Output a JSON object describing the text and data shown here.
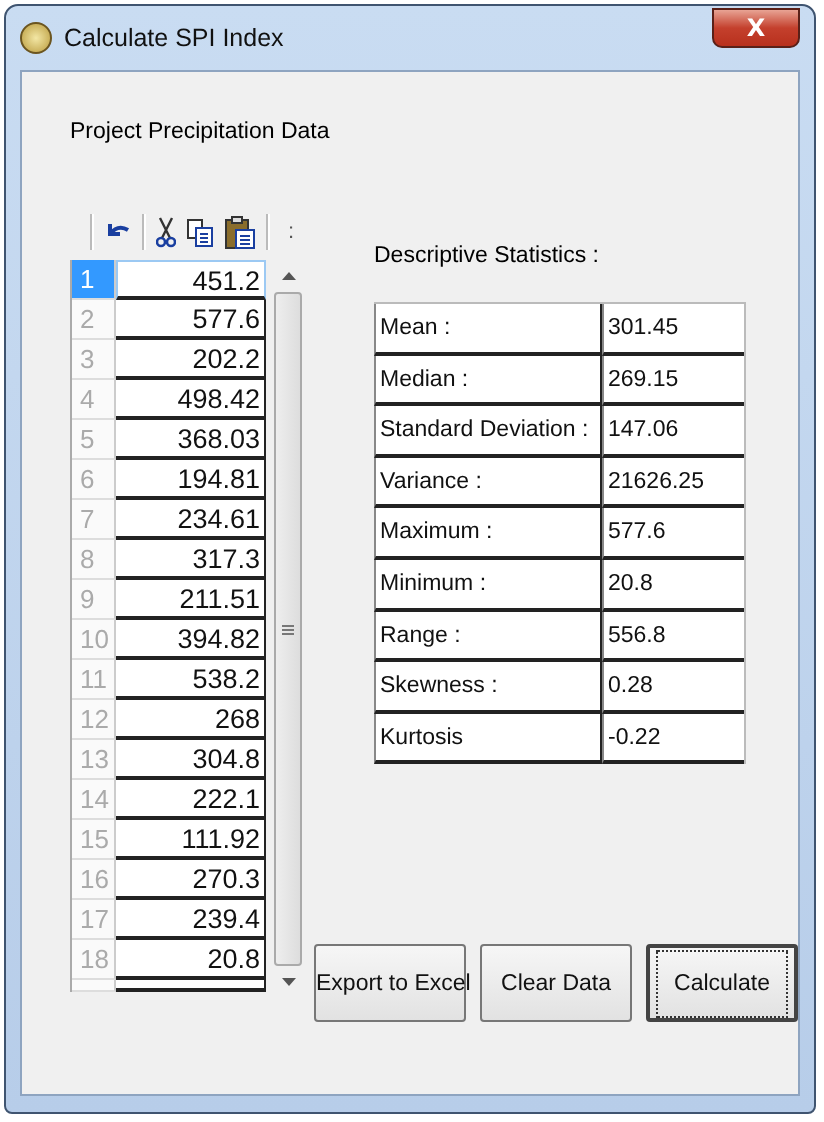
{
  "window": {
    "title": "Calculate SPI Index",
    "close": "X"
  },
  "section_label": "Project Precipitation Data",
  "toolbar": {
    "overflow": ":"
  },
  "grid": {
    "rows": [
      {
        "number": "1",
        "value": "451.2",
        "selected": true
      },
      {
        "number": "2",
        "value": "577.6",
        "selected": false
      },
      {
        "number": "3",
        "value": "202.2",
        "selected": false
      },
      {
        "number": "4",
        "value": "498.42",
        "selected": false
      },
      {
        "number": "5",
        "value": "368.03",
        "selected": false
      },
      {
        "number": "6",
        "value": "194.81",
        "selected": false
      },
      {
        "number": "7",
        "value": "234.61",
        "selected": false
      },
      {
        "number": "8",
        "value": "317.3",
        "selected": false
      },
      {
        "number": "9",
        "value": "211.51",
        "selected": false
      },
      {
        "number": "10",
        "value": "394.82",
        "selected": false
      },
      {
        "number": "11",
        "value": "538.2",
        "selected": false
      },
      {
        "number": "12",
        "value": "268",
        "selected": false
      },
      {
        "number": "13",
        "value": "304.8",
        "selected": false
      },
      {
        "number": "14",
        "value": "222.1",
        "selected": false
      },
      {
        "number": "15",
        "value": "111.92",
        "selected": false
      },
      {
        "number": "16",
        "value": "270.3",
        "selected": false
      },
      {
        "number": "17",
        "value": "239.4",
        "selected": false
      },
      {
        "number": "18",
        "value": "20.8",
        "selected": false
      }
    ]
  },
  "statistics": {
    "title": "Descriptive Statistics :",
    "rows": [
      {
        "label": "Mean :",
        "value": "301.45"
      },
      {
        "label": "Median :",
        "value": "269.15"
      },
      {
        "label": "Standard Deviation :",
        "value": "147.06"
      },
      {
        "label": "Variance :",
        "value": "21626.25"
      },
      {
        "label": "Maximum :",
        "value": "577.6"
      },
      {
        "label": "Minimum :",
        "value": "20.8"
      },
      {
        "label": "Range :",
        "value": "556.8"
      },
      {
        "label": "Skewness :",
        "value": "0.28"
      },
      {
        "label": "Kurtosis",
        "value": "-0.22"
      }
    ]
  },
  "buttons": [
    {
      "label": "Export to Excel",
      "default": false
    },
    {
      "label": "Clear Data",
      "default": false
    },
    {
      "label": "Calculate",
      "default": true
    }
  ]
}
